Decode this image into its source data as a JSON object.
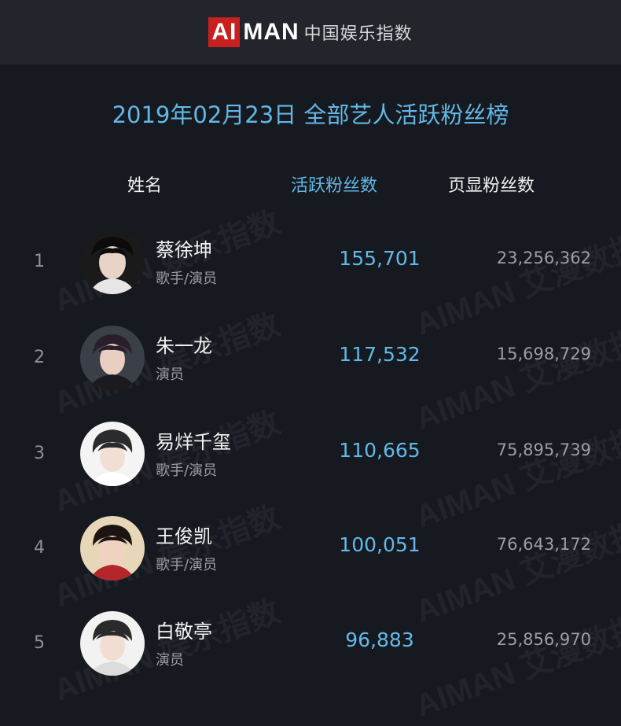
{
  "header": {
    "logo_ai": "AI",
    "logo_man": "MAN",
    "logo_cn": "中国娱乐指数"
  },
  "title": "2019年02月23日 全部艺人活跃粉丝榜",
  "columns": {
    "name": "姓名",
    "active_fans": "活跃粉丝数",
    "page_fans": "页显粉丝数"
  },
  "colors": {
    "background": "#16191f",
    "header": "#22252b",
    "accent": "#61b8e6",
    "logo_red": "#c8201f"
  },
  "rows": [
    {
      "rank": "1",
      "name": "蔡徐坤",
      "role": "歌手/演员",
      "active_fans": "155,701",
      "page_fans": "23,256,362",
      "avatar": "avatar-photo"
    },
    {
      "rank": "2",
      "name": "朱一龙",
      "role": "演员",
      "active_fans": "117,532",
      "page_fans": "15,698,729",
      "avatar": "avatar-photo"
    },
    {
      "rank": "3",
      "name": "易烊千玺",
      "role": "歌手/演员",
      "active_fans": "110,665",
      "page_fans": "75,895,739",
      "avatar": "avatar-photo"
    },
    {
      "rank": "4",
      "name": "王俊凯",
      "role": "歌手/演员",
      "active_fans": "100,051",
      "page_fans": "76,643,172",
      "avatar": "avatar-photo"
    },
    {
      "rank": "5",
      "name": "白敬亭",
      "role": "演员",
      "active_fans": "96,883",
      "page_fans": "25,856,970",
      "avatar": "avatar-photo"
    }
  ],
  "watermarks": [
    "AIMAN 娱乐指数",
    "AIMAN 艾漫数据"
  ]
}
